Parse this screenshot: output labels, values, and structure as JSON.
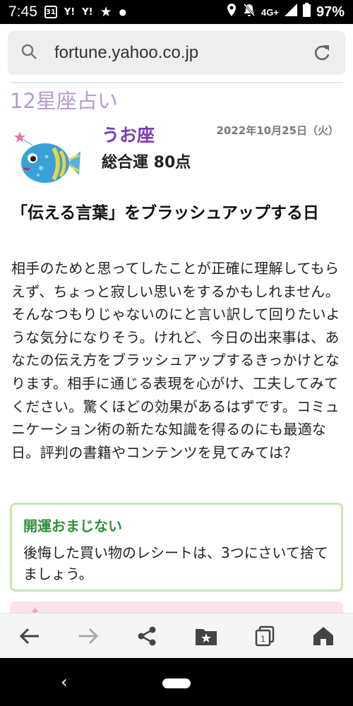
{
  "status_bar": {
    "time": "7:45",
    "calendar_day": "31",
    "yahoo_1": "Y!",
    "yahoo_2": "Y!",
    "network": "4G+",
    "battery": "97%"
  },
  "address_bar": {
    "url": "fortune.yahoo.co.jp"
  },
  "page": {
    "section_title": "12星座占い",
    "sign_name": "うお座",
    "date": "2022年10月25日（火）",
    "score_label": "総合運 80点",
    "headline": "「伝える言葉」をブラッシュアップする日",
    "body": "相手のためと思ってしたことが正確に理解してもらえず、ちょっと寂しい思いをするかもしれません。そんなつもりじゃないのにと言い訳して回りたいような気分になりそう。けれど、今日の出来事は、あなたの伝え方をブラッシュアップするきっかけとなります。相手に通じる表現を心がけ、工夫してみてください。驚くほどの効果があるはずです。コミュニケーション術の新たな知識を得るのにも最適な日。評判の書籍やコンテンツを見てみては？",
    "charm": {
      "title": "開運おまじない",
      "text": "後悔した買い物のレシートは、3つにさいて捨てましょう。"
    }
  },
  "toolbar": {
    "tab_count": "1"
  },
  "colors": {
    "section_title": "#b69ad2",
    "sign_name": "#7b3bb5",
    "charm_title": "#2f8f3a",
    "charm_border": "#c9e7b1"
  }
}
